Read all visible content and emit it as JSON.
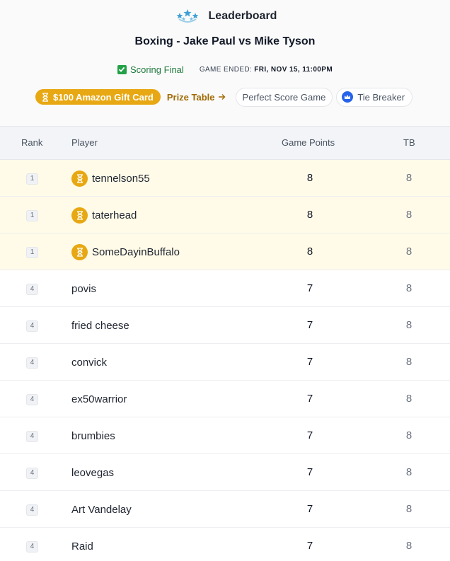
{
  "header": {
    "title": "Leaderboard",
    "logo_icon": "stars-icon",
    "game_title": "Boxing - Jake Paul vs Mike Tyson",
    "status_text": "Scoring Final",
    "ended_label": "GAME ENDED:",
    "ended_date": "FRI, NOV 15, 11:00PM"
  },
  "prizes": {
    "pill_label": "$100 Amazon Gift Card",
    "prize_table_link": "Prize Table",
    "perfect_score_chip": "Perfect Score Game",
    "tie_breaker_chip": "Tie Breaker"
  },
  "table": {
    "columns": {
      "rank": "Rank",
      "player": "Player",
      "points": "Game Points",
      "tb": "TB"
    },
    "rows": [
      {
        "rank": "1",
        "player": "tennelson55",
        "points": "8",
        "tb": "8",
        "winner": true
      },
      {
        "rank": "1",
        "player": "taterhead",
        "points": "8",
        "tb": "8",
        "winner": true
      },
      {
        "rank": "1",
        "player": "SomeDayinBuffalo",
        "points": "8",
        "tb": "8",
        "winner": true
      },
      {
        "rank": "4",
        "player": "povis",
        "points": "7",
        "tb": "8",
        "winner": false
      },
      {
        "rank": "4",
        "player": "fried cheese",
        "points": "7",
        "tb": "8",
        "winner": false
      },
      {
        "rank": "4",
        "player": "convick",
        "points": "7",
        "tb": "8",
        "winner": false
      },
      {
        "rank": "4",
        "player": "ex50warrior",
        "points": "7",
        "tb": "8",
        "winner": false
      },
      {
        "rank": "4",
        "player": "brumbies",
        "points": "7",
        "tb": "8",
        "winner": false
      },
      {
        "rank": "4",
        "player": "leovegas",
        "points": "7",
        "tb": "8",
        "winner": false
      },
      {
        "rank": "4",
        "player": "Art Vandelay",
        "points": "7",
        "tb": "8",
        "winner": false
      },
      {
        "rank": "4",
        "player": "Raid",
        "points": "7",
        "tb": "8",
        "winner": false
      }
    ]
  },
  "colors": {
    "accent_gold": "#e8a813",
    "winner_row_bg": "#fffbe8",
    "status_green": "#22a146",
    "crown_blue": "#2563eb"
  }
}
